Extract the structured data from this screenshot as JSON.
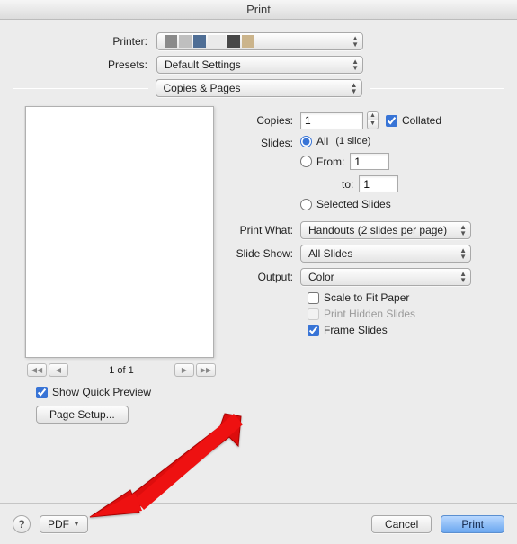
{
  "title": "Print",
  "top": {
    "printer_label": "Printer:",
    "presets_label": "Presets:",
    "presets_value": "Default Settings"
  },
  "filter": {
    "value": "Copies & Pages"
  },
  "preview": {
    "page_indicator": "1 of 1"
  },
  "copies": {
    "label": "Copies:",
    "value": "1",
    "collated": "Collated"
  },
  "slides": {
    "label": "Slides:",
    "all": "All",
    "count_note": "(1 slide)",
    "from": "From:",
    "from_value": "1",
    "to": "to:",
    "to_value": "1",
    "selected": "Selected Slides"
  },
  "print_what": {
    "label": "Print What:",
    "value": "Handouts (2 slides per page)"
  },
  "slide_show": {
    "label": "Slide Show:",
    "value": "All Slides"
  },
  "output": {
    "label": "Output:",
    "value": "Color"
  },
  "options": {
    "scale": "Scale to Fit Paper",
    "hidden": "Print Hidden Slides",
    "frame": "Frame Slides"
  },
  "quick_preview": "Show Quick Preview",
  "page_setup": "Page Setup...",
  "bottom": {
    "pdf": "PDF",
    "cancel": "Cancel",
    "print": "Print"
  }
}
